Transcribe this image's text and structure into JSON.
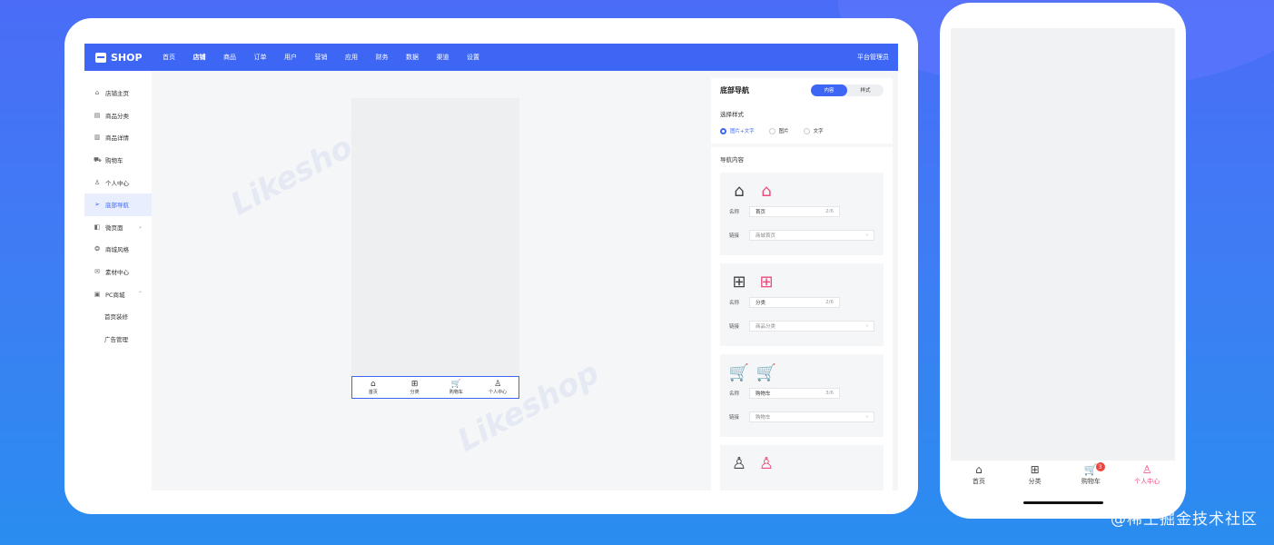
{
  "brand": "SHOP",
  "topnav": [
    "首页",
    "店铺",
    "商品",
    "订单",
    "用户",
    "营销",
    "应用",
    "财务",
    "数据",
    "渠道",
    "设置"
  ],
  "admin_label": "平台管理员",
  "sidebar": [
    {
      "label": "店铺主页",
      "icon": "home-icon",
      "glyph": "⌂"
    },
    {
      "label": "商品分类",
      "icon": "category-icon",
      "glyph": "▤"
    },
    {
      "label": "商品详情",
      "icon": "detail-icon",
      "glyph": "▥"
    },
    {
      "label": "购物车",
      "icon": "cart-icon",
      "glyph": "⛟"
    },
    {
      "label": "个人中心",
      "icon": "user-icon",
      "glyph": "♙"
    },
    {
      "label": "底部导航",
      "icon": "send-icon",
      "glyph": "➢",
      "active": true
    },
    {
      "label": "微页面",
      "icon": "page-icon",
      "glyph": "◧",
      "chev": "⌄"
    },
    {
      "label": "商城风格",
      "icon": "palette-icon",
      "glyph": "❂"
    },
    {
      "label": "素材中心",
      "icon": "image-icon",
      "glyph": "✉"
    },
    {
      "label": "PC商城",
      "icon": "pc-icon",
      "glyph": "▣",
      "chev": "⌃"
    },
    {
      "label": "首页装修",
      "sub": true
    },
    {
      "label": "广告管理",
      "sub": true
    }
  ],
  "preview_nav": [
    {
      "label": "首页",
      "glyph": "⌂",
      "icon": "home-icon"
    },
    {
      "label": "分类",
      "glyph": "⊞",
      "icon": "grid-icon"
    },
    {
      "label": "购物车",
      "glyph": "🛒",
      "icon": "cart-icon"
    },
    {
      "label": "个人中心",
      "glyph": "♙",
      "icon": "user-icon"
    }
  ],
  "panel": {
    "title": "底部导航",
    "tabs": [
      "内容",
      "样式"
    ],
    "style_label": "选择样式",
    "radios": [
      "图片+文字",
      "图片",
      "文字"
    ],
    "content_label": "导航内容",
    "name_label": "名称",
    "link_label": "链接",
    "cards": [
      {
        "name": "首页",
        "count": "2/6",
        "link": "商城首页",
        "glyph": "⌂"
      },
      {
        "name": "分类",
        "count": "2/6",
        "link": "商品分类",
        "glyph": "⊞"
      },
      {
        "name": "购物车",
        "count": "3/6",
        "link": "购物车",
        "glyph": "🛒"
      },
      {
        "name": "",
        "count": "",
        "link": "",
        "glyph": "♙"
      }
    ]
  },
  "phone_tabs": [
    {
      "label": "首页",
      "glyph": "⌂",
      "icon": "home-icon"
    },
    {
      "label": "分类",
      "glyph": "⊞",
      "icon": "grid-icon"
    },
    {
      "label": "购物车",
      "glyph": "🛒",
      "icon": "cart-icon",
      "badge": "3"
    },
    {
      "label": "个人中心",
      "glyph": "♙",
      "icon": "user-icon",
      "active": true
    }
  ],
  "watermark": "Likeshop",
  "credit": "@稀土掘金技术社区",
  "colors": {
    "accent": "#3e66f5",
    "pink": "#ee4a7c",
    "badge": "#f0443e"
  }
}
